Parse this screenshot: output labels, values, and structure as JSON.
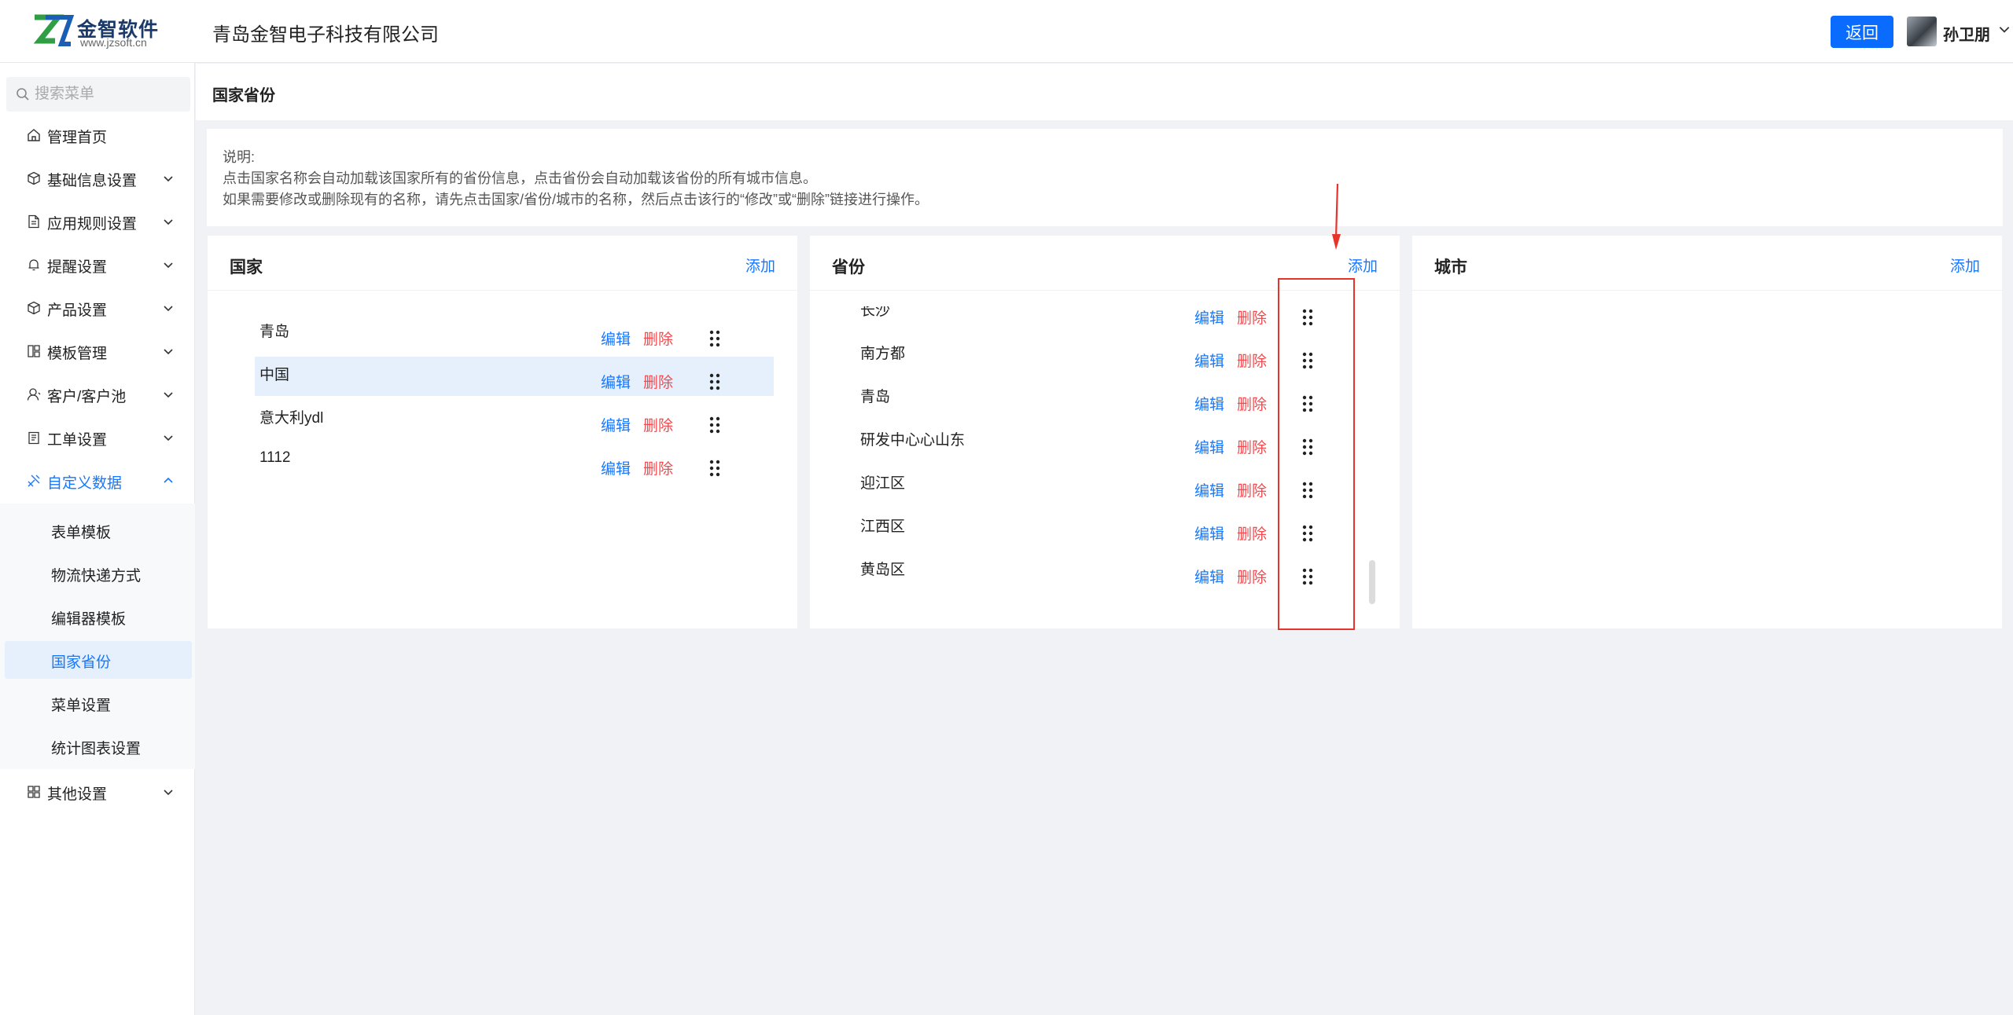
{
  "header": {
    "brand": "金智软件",
    "brand_url": "www.jzsoft.cn",
    "company": "青岛金智电子科技有限公司",
    "back_label": "返回",
    "username": "孙卫朋"
  },
  "sidebar": {
    "search_placeholder": "搜索菜单",
    "items": [
      {
        "label": "管理首页",
        "icon": "home-icon"
      },
      {
        "label": "基础信息设置",
        "icon": "cube-icon"
      },
      {
        "label": "应用规则设置",
        "icon": "file-icon"
      },
      {
        "label": "提醒设置",
        "icon": "bell-icon"
      },
      {
        "label": "产品设置",
        "icon": "box-icon"
      },
      {
        "label": "模板管理",
        "icon": "layout-icon"
      },
      {
        "label": "客户/客户池",
        "icon": "user-icon"
      },
      {
        "label": "工单设置",
        "icon": "clipboard-icon"
      },
      {
        "label": "自定义数据",
        "icon": "custom-data-icon"
      },
      {
        "label": "其他设置",
        "icon": "grid-icon"
      }
    ],
    "submenu": [
      {
        "label": "表单模板"
      },
      {
        "label": "物流快递方式"
      },
      {
        "label": "编辑器模板"
      },
      {
        "label": "国家省份"
      },
      {
        "label": "菜单设置"
      },
      {
        "label": "统计图表设置"
      }
    ]
  },
  "main": {
    "page_title": "国家省份",
    "note": {
      "line1": "说明:",
      "line2": "点击国家名称会自动加载该国家所有的省份信息，点击省份会自动加载该省份的所有城市信息。",
      "line3": "如果需要修改或删除现有的名称，请先点击国家/省份/城市的名称，然后点击该行的“修改”或“删除”链接进行操作。"
    },
    "country_panel": {
      "title": "国家",
      "add_label": "添加",
      "rows": [
        {
          "name": "青岛",
          "edit": "编辑",
          "delete": "删除"
        },
        {
          "name": "中国",
          "edit": "编辑",
          "delete": "删除"
        },
        {
          "name": "意大利ydl",
          "edit": "编辑",
          "delete": "删除"
        },
        {
          "name": "1112",
          "edit": "编辑",
          "delete": "删除"
        }
      ]
    },
    "province_panel": {
      "title": "省份",
      "add_label": "添加",
      "rows": [
        {
          "name": "长沙",
          "edit": "编辑",
          "delete": "删除"
        },
        {
          "name": "南方都",
          "edit": "编辑",
          "delete": "删除"
        },
        {
          "name": "青岛",
          "edit": "编辑",
          "delete": "删除"
        },
        {
          "name": "研发中心心山东",
          "edit": "编辑",
          "delete": "删除"
        },
        {
          "name": "迎江区",
          "edit": "编辑",
          "delete": "删除"
        },
        {
          "name": "江西区",
          "edit": "编辑",
          "delete": "删除"
        },
        {
          "name": "黄岛区",
          "edit": "编辑",
          "delete": "删除"
        }
      ]
    },
    "city_panel": {
      "title": "城市",
      "add_label": "添加"
    }
  },
  "colors": {
    "primary": "#1677ff",
    "danger": "#f5494d",
    "highlight_row": "#e6f0fd",
    "annotation_red": "#e8332a"
  }
}
